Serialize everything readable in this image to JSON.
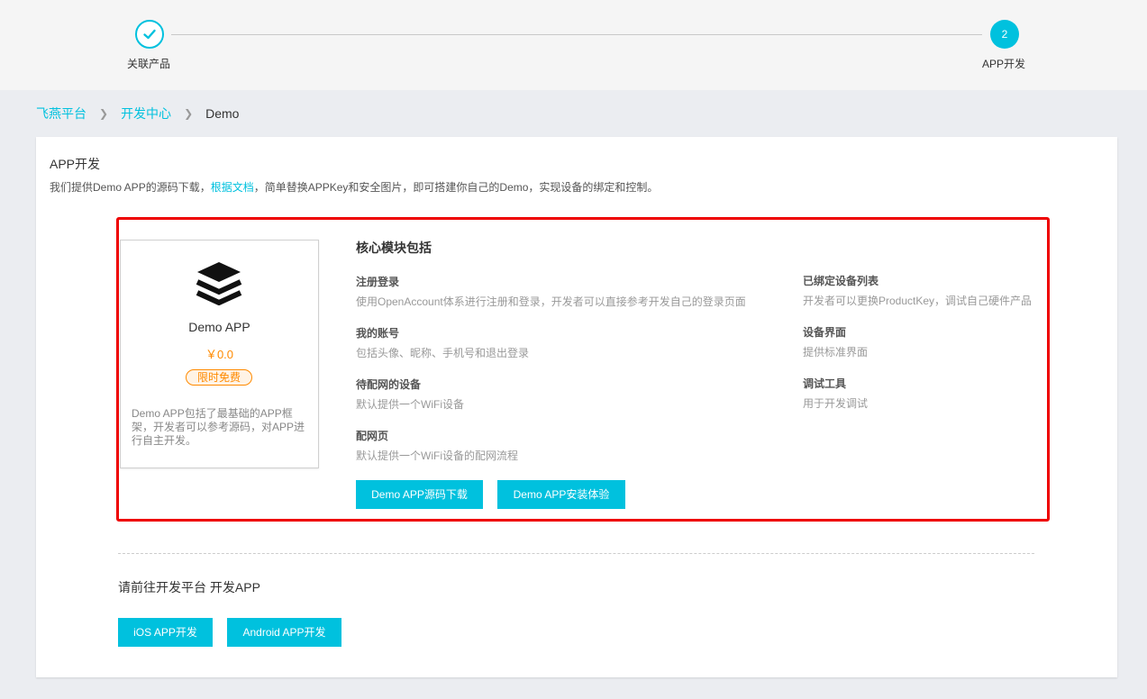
{
  "steps": [
    {
      "label": "关联产品",
      "status": "done"
    },
    {
      "label": "APP开发",
      "number": "2",
      "status": "active"
    }
  ],
  "breadcrumb": {
    "items": [
      {
        "label": "飞燕平台"
      },
      {
        "label": "开发中心"
      },
      {
        "label": "Demo"
      }
    ]
  },
  "main": {
    "title": "APP开发",
    "desc_before": "我们提供Demo APP的源码下载，",
    "desc_link": "根据文档",
    "desc_after": "，简单替换APPKey和安全图片，即可搭建你自己的Demo，实现设备的绑定和控制。"
  },
  "app_card": {
    "icon": "layers-icon",
    "name": "Demo APP",
    "price": "￥0.0",
    "badge": "限时免费",
    "desc": "Demo APP包括了最基础的APP框架，开发者可以参考源码，对APP进行自主开发。"
  },
  "core": {
    "title": "核心模块包括",
    "features_left": [
      {
        "title": "注册登录",
        "desc": "使用OpenAccount体系进行注册和登录，开发者可以直接参考开发自己的登录页面"
      },
      {
        "title": "我的账号",
        "desc": "包括头像、昵称、手机号和退出登录"
      },
      {
        "title": "待配网的设备",
        "desc": "默认提供一个WiFi设备"
      },
      {
        "title": "配网页",
        "desc": "默认提供一个WiFi设备的配网流程"
      }
    ],
    "features_right": [
      {
        "title": "已绑定设备列表",
        "desc": "开发者可以更换ProductKey，调试自己硬件产品"
      },
      {
        "title": "设备界面",
        "desc": "提供标准界面"
      },
      {
        "title": "调试工具",
        "desc": "用于开发调试"
      }
    ],
    "buttons": {
      "source_download": "Demo APP源码下载",
      "install_experience": "Demo APP安装体验"
    }
  },
  "platform": {
    "title": "请前往开发平台 开发APP",
    "ios_button": "iOS APP开发",
    "android_button": "Android APP开发"
  },
  "colors": {
    "accent": "#00c1de",
    "price": "#ff8a00",
    "highlight_border": "#ee0000"
  }
}
